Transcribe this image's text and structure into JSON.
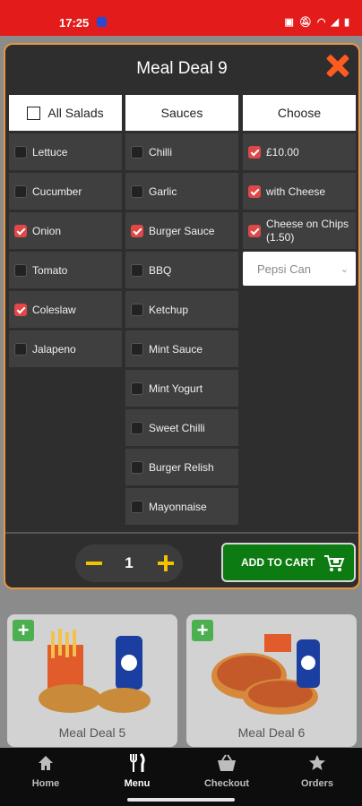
{
  "status_bar": {
    "time": "17:25",
    "icons": [
      "nfc-icon",
      "mute-icon",
      "wifi-icon",
      "signal-icon",
      "battery-icon"
    ]
  },
  "background": {
    "cards": [
      {
        "title": "Meal Deal 5"
      },
      {
        "title": "Meal Deal 6"
      }
    ]
  },
  "modal": {
    "title": "Meal Deal 9",
    "columns": {
      "salads": {
        "header": "All Salads",
        "items": [
          {
            "label": "Lettuce",
            "checked": false
          },
          {
            "label": "Cucumber",
            "checked": false
          },
          {
            "label": "Onion",
            "checked": true
          },
          {
            "label": "Tomato",
            "checked": false
          },
          {
            "label": "Coleslaw",
            "checked": true
          },
          {
            "label": "Jalapeno",
            "checked": false
          }
        ]
      },
      "sauces": {
        "header": "Sauces",
        "items": [
          {
            "label": "Chilli",
            "checked": false
          },
          {
            "label": "Garlic",
            "checked": false
          },
          {
            "label": "Burger Sauce",
            "checked": true
          },
          {
            "label": "BBQ",
            "checked": false
          },
          {
            "label": "Ketchup",
            "checked": false
          },
          {
            "label": "Mint Sauce",
            "checked": false
          },
          {
            "label": "Mint Yogurt",
            "checked": false
          },
          {
            "label": "Sweet Chilli",
            "checked": false
          },
          {
            "label": "Burger Relish",
            "checked": false
          },
          {
            "label": "Mayonnaise",
            "checked": false
          }
        ]
      },
      "choose": {
        "header": "Choose",
        "items": [
          {
            "label": "£10.00",
            "checked": true
          },
          {
            "label": "with Cheese",
            "checked": true
          },
          {
            "label": "Cheese on Chips (1.50)",
            "checked": true
          }
        ],
        "drink_select": {
          "value": "Pepsi Can"
        }
      }
    },
    "quantity": "1",
    "add_to_cart": "ADD TO CART"
  },
  "nav": {
    "items": [
      {
        "label": "Home",
        "icon": "home-icon"
      },
      {
        "label": "Menu",
        "icon": "cutlery-icon"
      },
      {
        "label": "Checkout",
        "icon": "basket-icon"
      },
      {
        "label": "Orders",
        "icon": "star-icon"
      }
    ],
    "active": "Menu"
  },
  "colors": {
    "status_bar": "#e31b1b",
    "modal_border": "#e89540",
    "close": "#ff5a1f",
    "checked": "#e04848",
    "add_to_cart": "#0c7b12",
    "stepper_accent": "#f2c200"
  }
}
